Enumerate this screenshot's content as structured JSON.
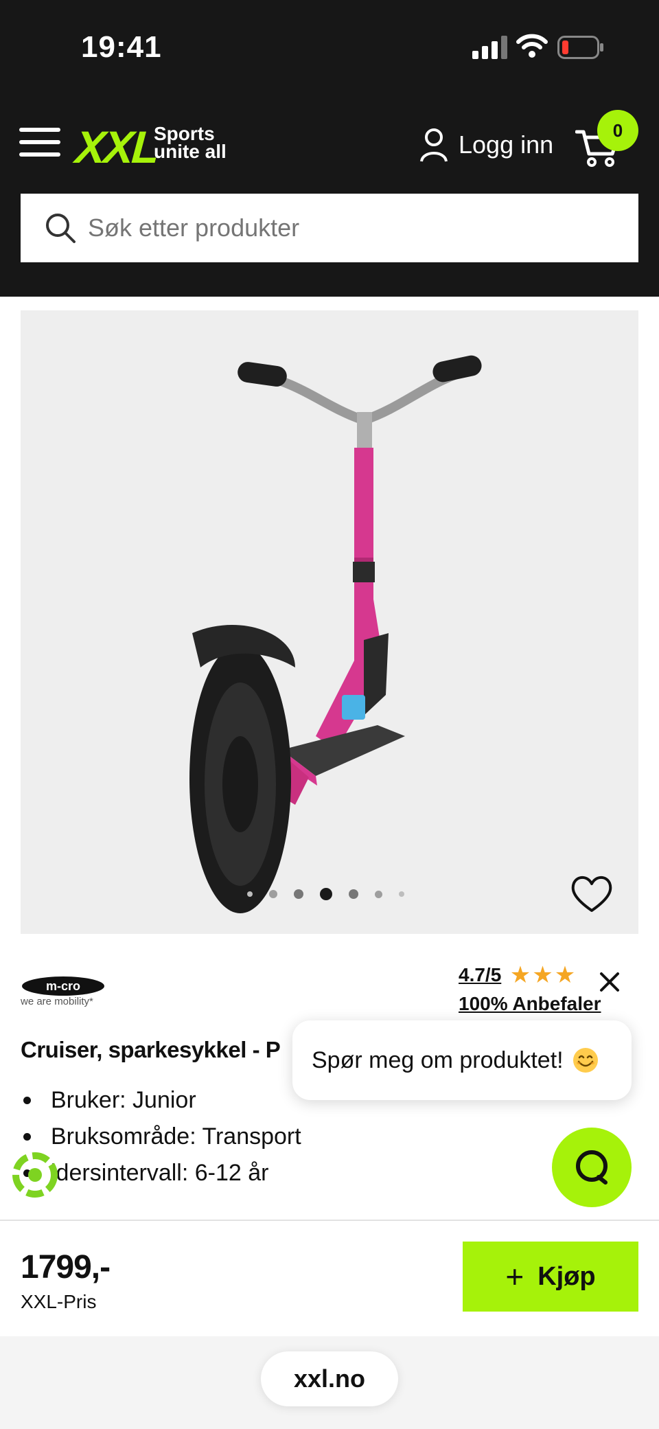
{
  "status_bar": {
    "time": "19:41"
  },
  "header": {
    "logo": {
      "mark": "XXL",
      "tagline_line1": "Sports",
      "tagline_line2": "unite all"
    },
    "login_label": "Logg inn",
    "cart_count": "0"
  },
  "search": {
    "placeholder": "Søk etter produkter"
  },
  "product": {
    "carousel": {
      "total_images": 7,
      "active_index": 3
    },
    "brand": {
      "logo_text": "m-cro",
      "tagline": "we are mobility*"
    },
    "rating": {
      "score": "4.7/5",
      "stars": "★★★",
      "recommend": "100% Anbefaler"
    },
    "title": "Cruiser, sparkesykkel - P",
    "specs": [
      "Bruker: Junior",
      "Bruksområde: Transport",
      "ldersintervall: 6-12 år"
    ]
  },
  "chat": {
    "bubble_text": "Spør meg om produktet!"
  },
  "buy_bar": {
    "price": "1799,-",
    "price_label": "XXL-Pris",
    "buy_label": "Kjøp"
  },
  "browser": {
    "url": "xxl.no"
  },
  "colors": {
    "brand_green": "#a6f20a",
    "header_bg": "#171717",
    "star": "#f5a623",
    "scooter_pink": "#d6388f"
  }
}
